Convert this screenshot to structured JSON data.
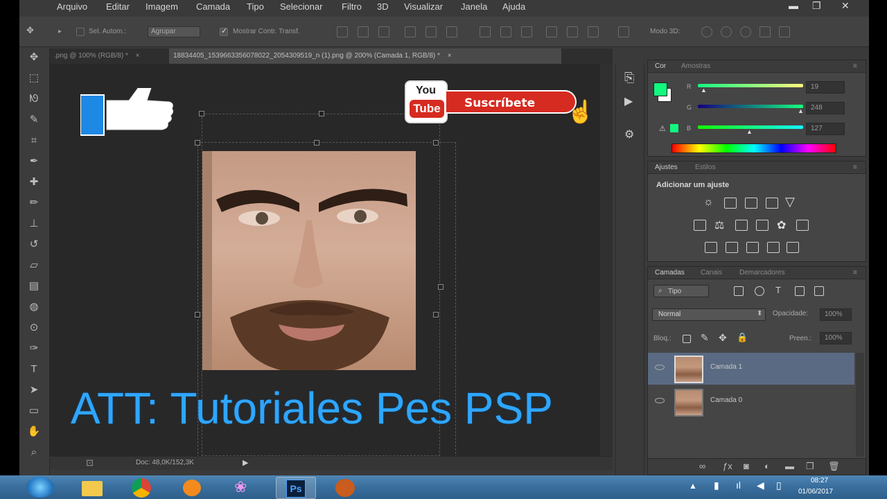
{
  "menu": [
    "Arquivo",
    "Editar",
    "Imagem",
    "Camada",
    "Tipo",
    "Selecionar",
    "Filtro",
    "3D",
    "Visualizar",
    "Janela",
    "Ajuda"
  ],
  "window_controls": {
    "minimize": "▬",
    "restore": "❐",
    "close": "✕"
  },
  "options_bar": {
    "auto_select_label": "Sel. Autom.:",
    "auto_select_value": "Agrupar",
    "show_transform_label": "Mostrar Contr. Transf.",
    "mode_3d_label": "Modo 3D:"
  },
  "tools": [
    "move-tool",
    "marquee-tool",
    "lasso-tool",
    "quick-select-tool",
    "crop-tool",
    "eyedropper-tool",
    "healing-tool",
    "brush-tool",
    "clone-stamp-tool",
    "history-brush-tool",
    "eraser-tool",
    "gradient-tool",
    "blur-tool",
    "dodge-tool",
    "pen-tool",
    "type-tool",
    "path-select-tool",
    "shape-tool",
    "hand-tool",
    "zoom-tool"
  ],
  "doc_tabs": [
    {
      "label": ".png @ 100% (RGB/8) *",
      "close": "×",
      "active": false
    },
    {
      "label": "18834405_1539663356078022_2054309519_n (1).png @ 200% (Camada 1, RGB/8) *",
      "close": "×",
      "active": true
    }
  ],
  "status": {
    "doc_size": "Doc: 48,0K/152,3K"
  },
  "overlay": {
    "title": "ATT: Tutoriales Pes PSP",
    "subscribe": "Suscríbete",
    "youtube_top": "You",
    "youtube_bottom": "Tube"
  },
  "color_panel": {
    "tabs": [
      "Cor",
      "Amostras"
    ],
    "channels": [
      {
        "label": "R",
        "value": "19",
        "level": 0.07
      },
      {
        "label": "G",
        "value": "248",
        "level": 0.97
      },
      {
        "label": "B",
        "value": "127",
        "level": 0.5
      }
    ],
    "foreground_color": "#13f87f",
    "background_color": "#ffffff"
  },
  "adjustments_panel": {
    "tabs": [
      "Ajustes",
      "Estilos"
    ],
    "heading": "Adicionar um ajuste"
  },
  "layers_panel": {
    "tabs": [
      "Camadas",
      "Canais",
      "Demarcadores"
    ],
    "filter_label": "Tipo",
    "blend_mode": "Normal",
    "opacity_label": "Opacidade:",
    "opacity_value": "100%",
    "lock_label": "Bloq.:",
    "fill_label": "Preen.:",
    "fill_value": "100%",
    "layers": [
      {
        "name": "Camada 1",
        "selected": true
      },
      {
        "name": "Camada 0",
        "selected": false
      }
    ]
  },
  "taskbar": {
    "time": "08:27",
    "date": "01/06/2017",
    "ps_label": "Ps"
  }
}
